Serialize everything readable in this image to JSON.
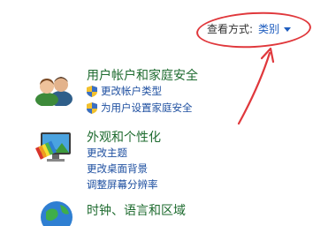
{
  "view_by": {
    "label": "查看方式:",
    "value": "类别"
  },
  "categories": [
    {
      "title": "用户帐户和家庭安全",
      "links": [
        "更改帐户类型",
        "为用户设置家庭安全"
      ]
    },
    {
      "title": "外观和个性化",
      "links": [
        "更改主题",
        "更改桌面背景",
        "调整屏幕分辨率"
      ]
    },
    {
      "title": "时钟、语言和区域",
      "links": []
    }
  ],
  "colors": {
    "category_title": "#1e6b2f",
    "link": "#1e4fa0",
    "annotation": "#e0383c"
  }
}
